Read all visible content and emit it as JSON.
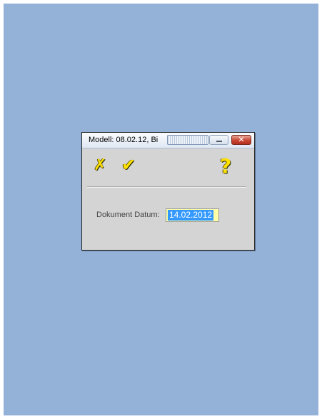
{
  "window": {
    "title": "Modell: 08.02.12,  Bi",
    "minimize_icon": "minimize-icon",
    "close_glyph": "✕"
  },
  "toolbar": {
    "cancel_glyph": "✗",
    "ok_glyph": "✔",
    "help_glyph": "?"
  },
  "form": {
    "date_label": "Dokument Datum:",
    "date_value": "14.02.2012"
  },
  "colors": {
    "desktop": "#94b1d7",
    "dialog": "#d4d4d4",
    "field_bg": "#ffffa8",
    "selection": "#3399ff",
    "tool_icons": "#ffe100"
  }
}
